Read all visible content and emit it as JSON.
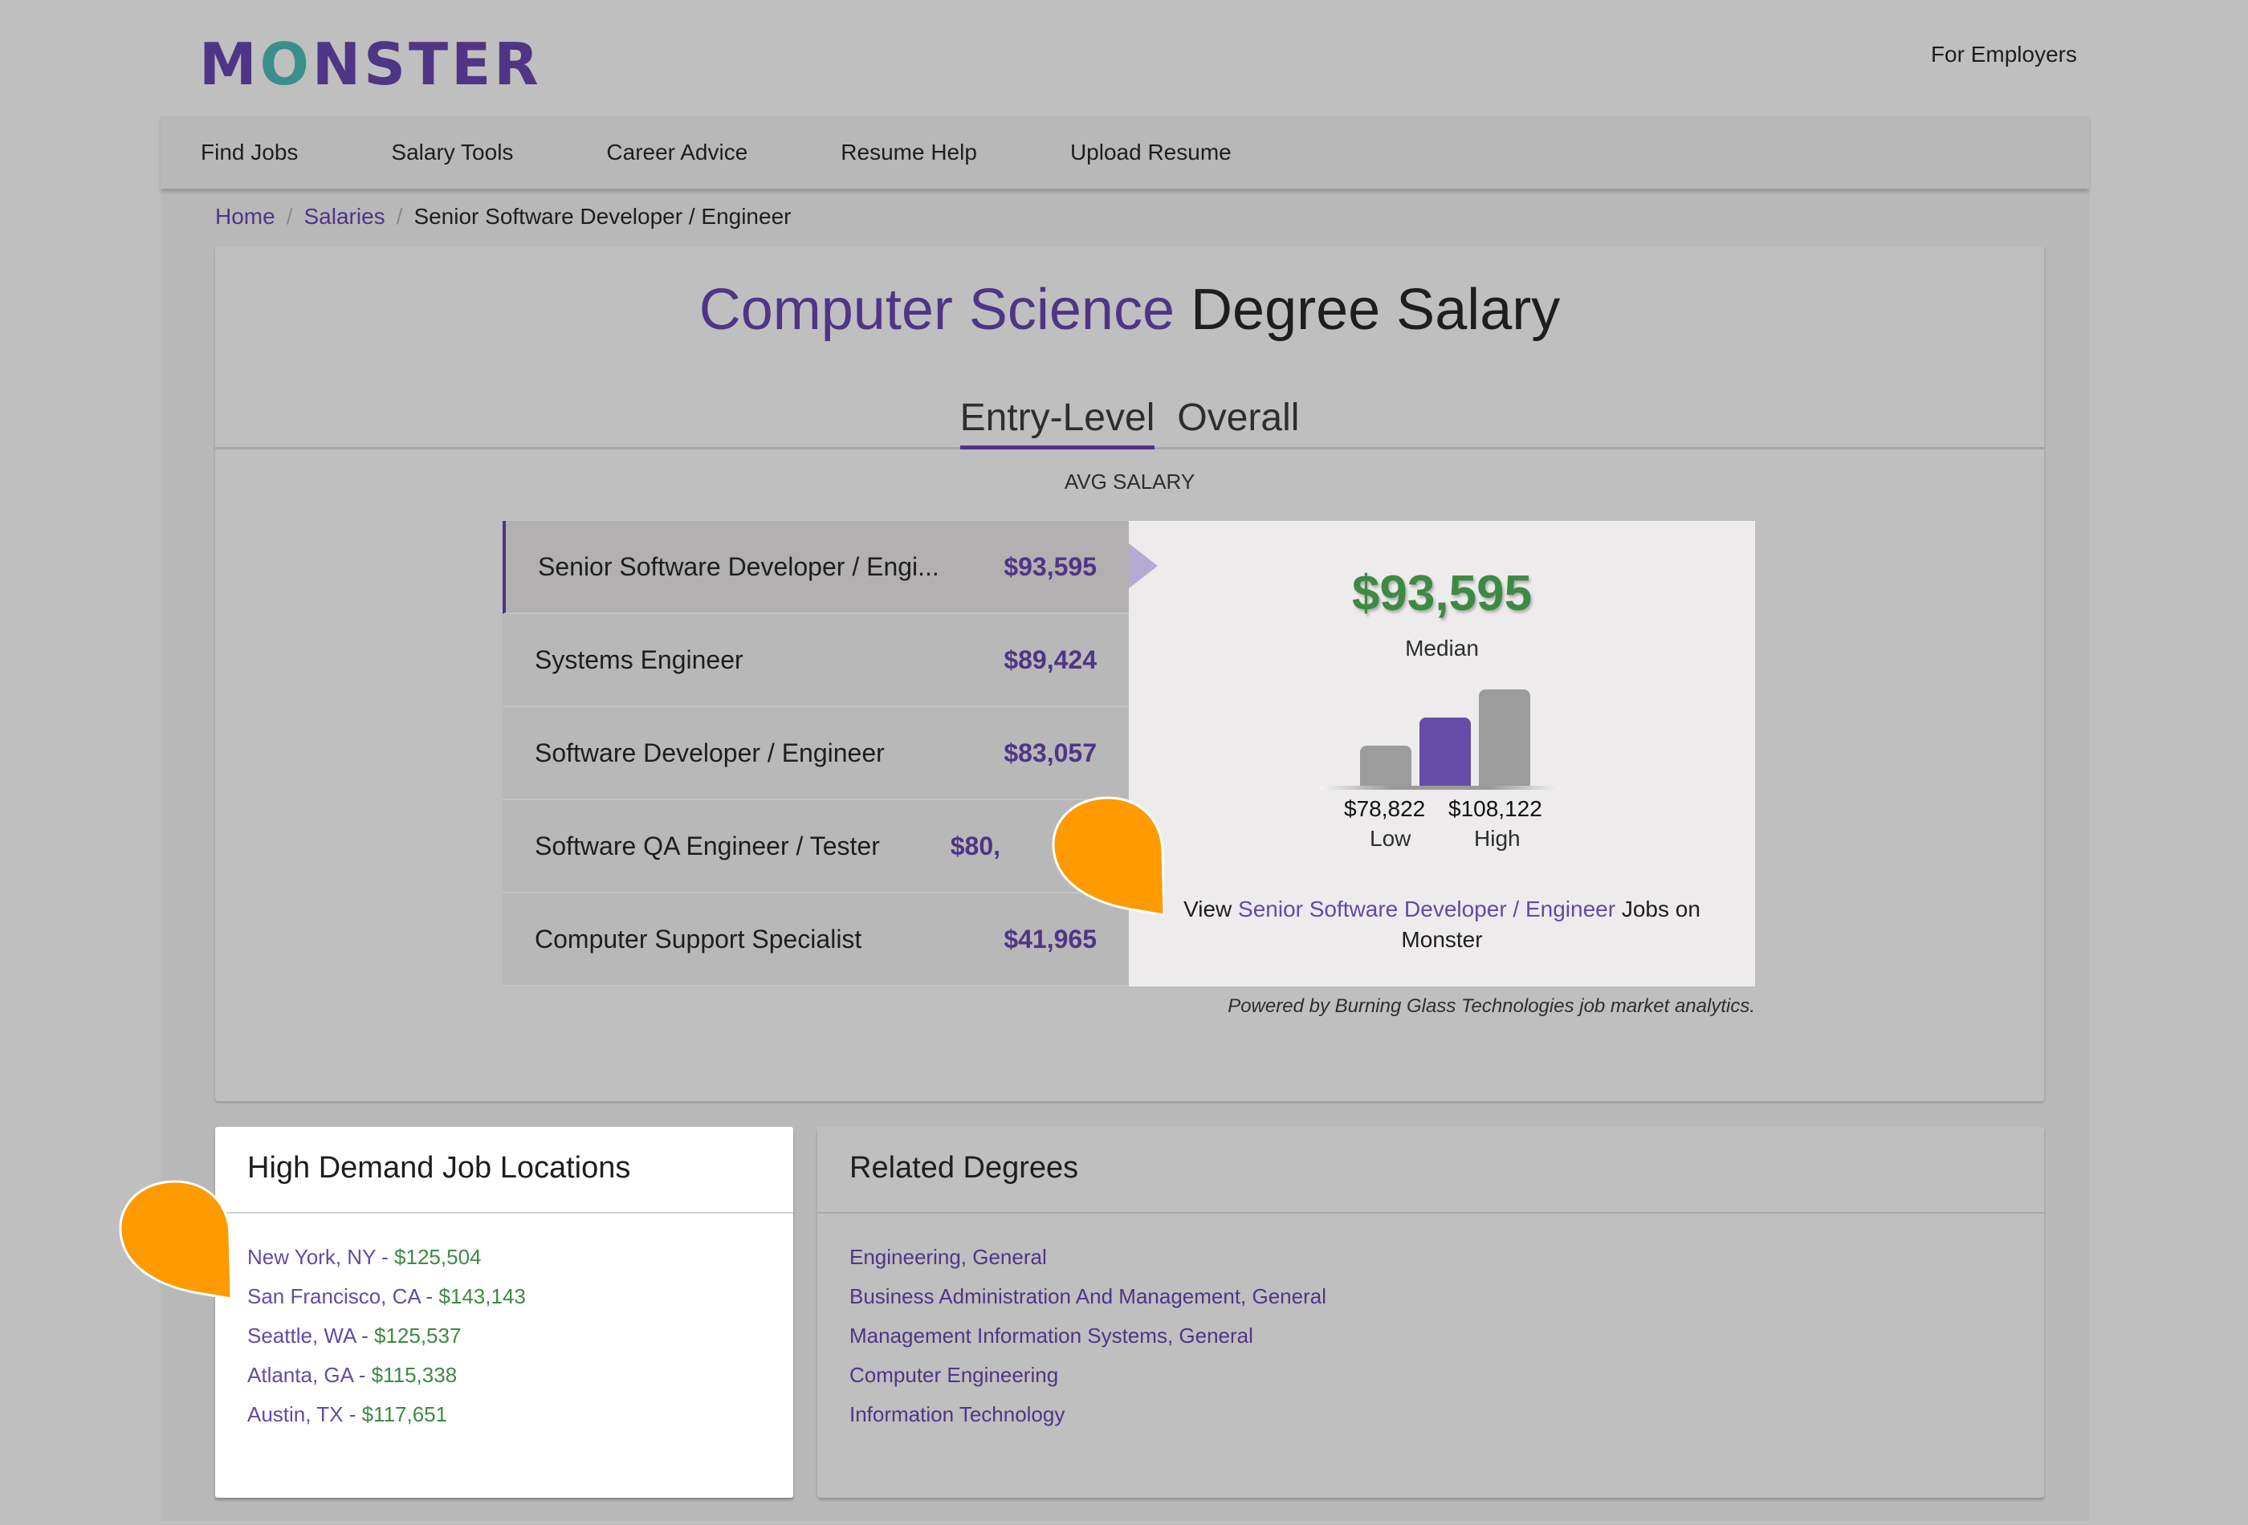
{
  "header": {
    "logo": {
      "prefix": "M",
      "o": "O",
      "suffix": "NSTER"
    },
    "for_employers": "For Employers"
  },
  "nav": {
    "items": [
      "Find Jobs",
      "Salary Tools",
      "Career Advice",
      "Resume Help",
      "Upload Resume"
    ]
  },
  "breadcrumb": {
    "home": "Home",
    "salaries": "Salaries",
    "current": "Senior Software Developer / Engineer",
    "separator": "/"
  },
  "salary_section": {
    "title_accent": "Computer Science",
    "title_rest": "Degree Salary",
    "tabs": [
      {
        "label": "Entry-Level",
        "active": true
      },
      {
        "label": "Overall",
        "active": false
      }
    ],
    "avg_label": "AVG SALARY",
    "jobs": [
      {
        "name": "Senior Software Developer / Engi...",
        "salary": "$93,595",
        "selected": true
      },
      {
        "name": "Systems Engineer",
        "salary": "$89,424",
        "selected": false
      },
      {
        "name": "Software Developer / Engineer",
        "salary": "$83,057",
        "selected": false
      },
      {
        "name": "Software QA Engineer / Tester",
        "salary": "$80,",
        "selected": false
      },
      {
        "name": "Computer Support Specialist",
        "salary": "$41,965",
        "selected": false
      }
    ],
    "detail": {
      "median_value": "$93,595",
      "median_label": "Median",
      "low_value": "$78,822",
      "low_label": "Low",
      "high_value": "$108,122",
      "high_label": "High",
      "view_prefix": "View",
      "view_link": "Senior Software Developer / Engineer",
      "view_suffix": "Jobs on Monster"
    },
    "powered_by": "Powered by Burning Glass Technologies job market analytics."
  },
  "chart_data": {
    "type": "bar",
    "categories": [
      "Low",
      "Median",
      "High"
    ],
    "values": [
      78822,
      93595,
      108122
    ],
    "colors": [
      "#9c9c9c",
      "#664ca8",
      "#9c9c9c"
    ],
    "title": "",
    "xlabel": "",
    "ylabel": ""
  },
  "locations": {
    "title": "High Demand Job Locations",
    "items": [
      {
        "city": "New York, NY",
        "salary": "$125,504"
      },
      {
        "city": "San Francisco, CA",
        "salary": "$143,143"
      },
      {
        "city": "Seattle, WA",
        "salary": "$125,537"
      },
      {
        "city": "Atlanta, GA",
        "salary": "$115,338"
      },
      {
        "city": "Austin, TX",
        "salary": "$117,651"
      }
    ]
  },
  "related_degrees": {
    "title": "Related Degrees",
    "items": [
      "Engineering, General",
      "Business Administration And Management, General",
      "Management Information Systems, General",
      "Computer Engineering",
      "Information Technology"
    ]
  },
  "colors": {
    "brand_purple": "#4f3585",
    "brand_teal": "#3b8f8a",
    "salary_green": "#3e8a43",
    "marker_orange": "#ff9a00"
  }
}
